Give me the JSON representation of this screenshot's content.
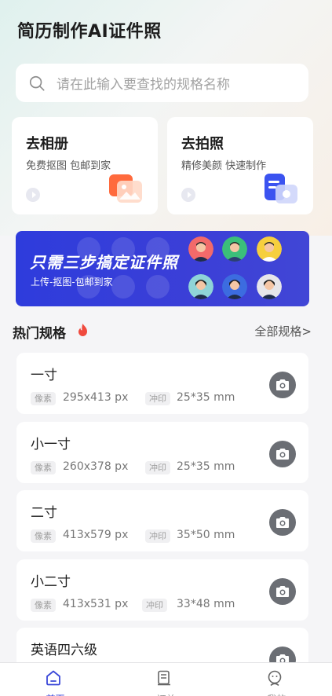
{
  "app": {
    "title": "简历制作AI证件照"
  },
  "search": {
    "placeholder": "请在此输入要查找的规格名称"
  },
  "actions": [
    {
      "title": "去相册",
      "subtitle": "免费抠图 包邮到家"
    },
    {
      "title": "去拍照",
      "subtitle": "精修美颜 快速制作"
    }
  ],
  "banner": {
    "title": "只需三步搞定证件照",
    "subtitle": "上传-抠图-包邮到家"
  },
  "section": {
    "title": "热门规格",
    "more": "全部规格>"
  },
  "tags": {
    "pixel": "像素",
    "print": "冲印"
  },
  "specs": [
    {
      "name": "一寸",
      "pixels": "295x413 px",
      "print": "25*35 mm"
    },
    {
      "name": "小一寸",
      "pixels": "260x378 px",
      "print": "25*35 mm"
    },
    {
      "name": "二寸",
      "pixels": "413x579 px",
      "print": "35*50 mm"
    },
    {
      "name": "小二寸",
      "pixels": "413x531 px",
      "print": "33*48 mm"
    },
    {
      "name": "英语四六级",
      "pixels": "",
      "print": ""
    }
  ],
  "tabs": [
    {
      "label": "首页",
      "icon": "home-icon",
      "active": true
    },
    {
      "label": "订单",
      "icon": "orders-icon",
      "active": false
    },
    {
      "label": "我的",
      "icon": "profile-icon",
      "active": false
    }
  ],
  "colors": {
    "accent": "#3a47d8",
    "banner": "#2e3cdc",
    "album": "#ff6a3d",
    "camera": "#3b53f0"
  }
}
